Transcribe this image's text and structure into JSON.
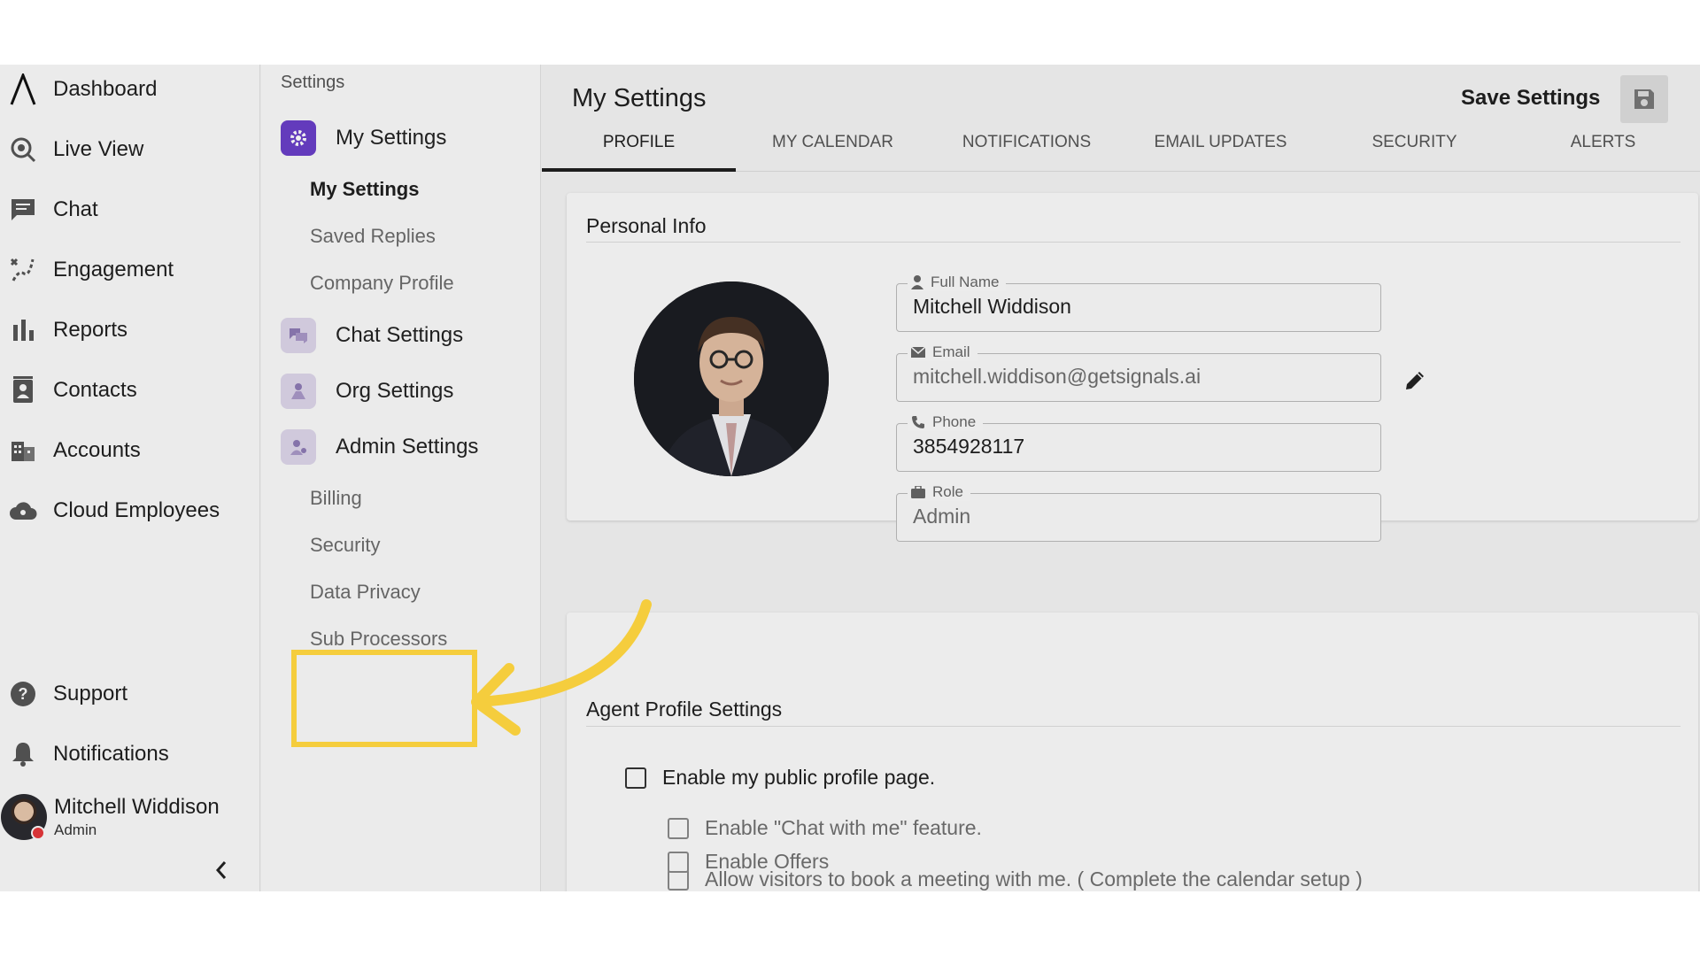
{
  "nav": {
    "items": [
      {
        "label": "Dashboard",
        "icon": "app-logo-icon"
      },
      {
        "label": "Live View",
        "icon": "live-view-icon"
      },
      {
        "label": "Chat",
        "icon": "chat-icon"
      },
      {
        "label": "Engagement",
        "icon": "engagement-icon"
      },
      {
        "label": "Reports",
        "icon": "bar-chart-icon"
      },
      {
        "label": "Contacts",
        "icon": "contacts-icon"
      },
      {
        "label": "Accounts",
        "icon": "building-icon"
      },
      {
        "label": "Cloud Employees",
        "icon": "cloud-icon"
      }
    ],
    "bottom": [
      {
        "label": "Support",
        "icon": "help-icon"
      },
      {
        "label": "Notifications",
        "icon": "bell-icon"
      }
    ],
    "user": {
      "name": "Mitchell Widdison",
      "role": "Admin"
    },
    "collapse": "‹"
  },
  "menu": {
    "title": "Settings",
    "sections": [
      {
        "label": "My Settings",
        "icon": "gear-icon"
      },
      {
        "label": "Chat Settings",
        "icon": "chat-bubbles-icon"
      },
      {
        "label": "Org Settings",
        "icon": "org-icon"
      },
      {
        "label": "Admin Settings",
        "icon": "admin-icon"
      }
    ],
    "my_settings_subs": [
      "My Settings",
      "Saved Replies",
      "Company Profile"
    ],
    "admin_subs": [
      "Billing",
      "Security",
      "Data Privacy",
      "Sub Processors"
    ]
  },
  "main": {
    "title": "My Settings",
    "save_label": "Save Settings",
    "tabs": [
      "PROFILE",
      "MY CALENDAR",
      "NOTIFICATIONS",
      "EMAIL UPDATES",
      "SECURITY",
      "ALERTS"
    ],
    "personal": {
      "title": "Personal Info",
      "fields": [
        {
          "label": "Full Name",
          "value": "Mitchell Widdison"
        },
        {
          "label": "Email",
          "value": "mitchell.widdison@getsignals.ai"
        },
        {
          "label": "Phone",
          "value": "3854928117"
        },
        {
          "label": "Role",
          "value": "Admin"
        }
      ]
    },
    "agent": {
      "title": "Agent Profile Settings",
      "options": [
        "Enable my public profile page.",
        "Enable \"Chat with me\" feature.",
        "Allow visitors to book a meeting with me. ( Complete the calendar setup )",
        "Enable Offers"
      ]
    }
  },
  "colors": {
    "accent": "#6a3fc8",
    "highlight": "#f5cd3d"
  }
}
